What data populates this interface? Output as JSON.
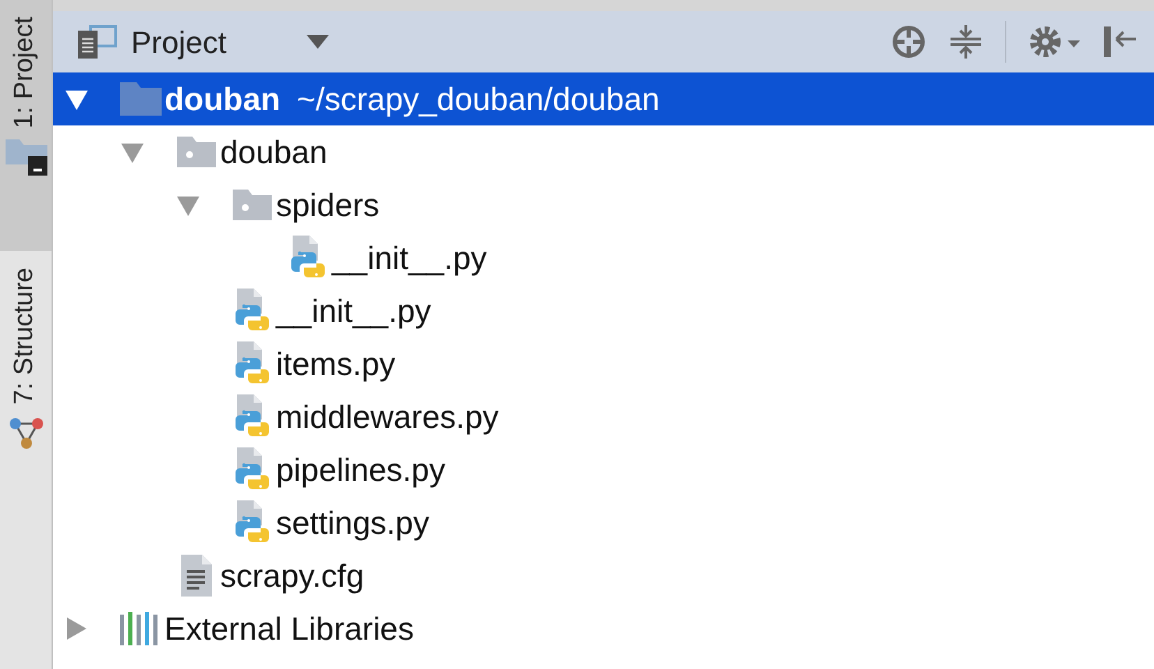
{
  "side_tabs": [
    {
      "label": "1: Project",
      "selected": true,
      "kind": "project"
    },
    {
      "label": "7: Structure",
      "selected": false,
      "kind": "structure"
    }
  ],
  "header": {
    "title": "Project"
  },
  "tree": [
    {
      "kind": "module",
      "name": "douban",
      "path": "~/scrapy_douban/douban",
      "selected": true,
      "expanded": true,
      "children": [
        {
          "kind": "folder",
          "name": "douban",
          "selected": false,
          "expanded": true,
          "children": [
            {
              "kind": "folder",
              "name": "spiders",
              "selected": false,
              "expanded": true,
              "children": [
                {
                  "kind": "python",
                  "name": "__init__.py",
                  "selected": false
                }
              ]
            },
            {
              "kind": "python",
              "name": "__init__.py",
              "selected": false
            },
            {
              "kind": "python",
              "name": "items.py",
              "selected": false
            },
            {
              "kind": "python",
              "name": "middlewares.py",
              "selected": false
            },
            {
              "kind": "python",
              "name": "pipelines.py",
              "selected": false
            },
            {
              "kind": "python",
              "name": "settings.py",
              "selected": false
            }
          ]
        },
        {
          "kind": "text",
          "name": "scrapy.cfg",
          "selected": false
        }
      ]
    },
    {
      "kind": "library",
      "name": "External Libraries",
      "selected": false,
      "expanded": false
    }
  ]
}
